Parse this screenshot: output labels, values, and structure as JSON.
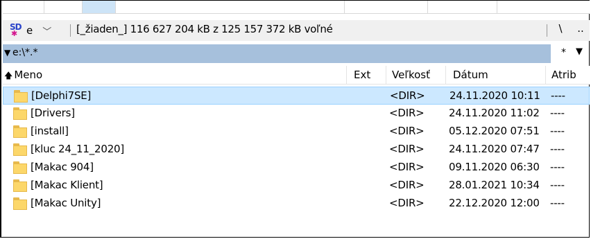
{
  "drive": {
    "letter": "e",
    "info": "[_žiaden_]  116 627 204 kB z 125 157 372 kB voľné",
    "root_button": "\\",
    "up_button": ".."
  },
  "path": {
    "arrow": "▼",
    "text": "e:\\*.*",
    "history_button": "*",
    "dropdown_button": "▼"
  },
  "columns": {
    "name": "Meno",
    "ext": "Ext",
    "size": "Veľkosť",
    "date": "Dátum",
    "attr": "Atrib",
    "sort_arrow": "🡅"
  },
  "files": [
    {
      "name": "[Delphi7SE]",
      "size": "<DIR>",
      "date": "24.11.2020 10:11",
      "attr": "----",
      "selected": true
    },
    {
      "name": "[Drivers]",
      "size": "<DIR>",
      "date": "24.11.2020 11:02",
      "attr": "----"
    },
    {
      "name": "[install]",
      "size": "<DIR>",
      "date": "05.12.2020 07:51",
      "attr": "----"
    },
    {
      "name": "[kluc 24_11_2020]",
      "size": "<DIR>",
      "date": "24.11.2020 07:47",
      "attr": "----"
    },
    {
      "name": "[Makac 904]",
      "size": "<DIR>",
      "date": "09.11.2020 06:30",
      "attr": "----"
    },
    {
      "name": "[Makac Klient]",
      "size": "<DIR>",
      "date": "28.01.2021 10:34",
      "attr": "----"
    },
    {
      "name": "[Makac Unity]",
      "size": "<DIR>",
      "date": "22.12.2020 12:00",
      "attr": "----"
    }
  ],
  "icons": {
    "drive": "drive-icon",
    "combo": "chevron-down-icon",
    "folder": "folder-icon"
  },
  "colors": {
    "path_bar": "#a6c0dc",
    "selection": "#cce8ff",
    "folder": "#fcd76a"
  }
}
